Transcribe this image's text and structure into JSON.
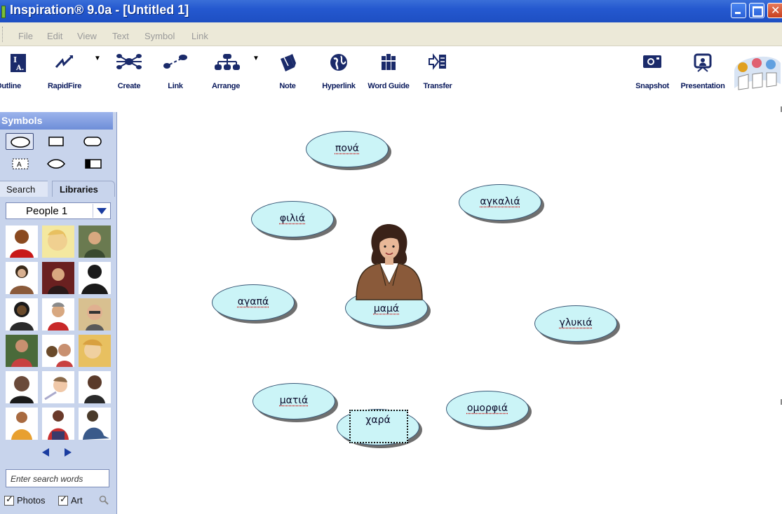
{
  "window": {
    "title": "Inspiration® 9.0a - [Untitled 1]"
  },
  "menu": [
    "File",
    "Edit",
    "View",
    "Text",
    "Symbol",
    "Link"
  ],
  "toolbar": {
    "outline": "Outline",
    "rapidfire": "RapidFire",
    "create": "Create",
    "link": "Link",
    "arrange": "Arrange",
    "note": "Note",
    "hyperlink": "Hyperlink",
    "word_guide": "Word Guide",
    "transfer": "Transfer",
    "snapshot": "Snapshot",
    "presentation": "Presentation"
  },
  "palette": {
    "title": "Symbols",
    "tabs": {
      "search": "Search",
      "libraries": "Libraries"
    },
    "library": "People 1",
    "search_placeholder": "Enter search words",
    "opt_photos": "Photos",
    "opt_art": "Art"
  },
  "diagram": {
    "center": "μαμά",
    "nodes": {
      "pona": "πονά",
      "agkalia": "αγκαλιά",
      "filia": "φιλιά",
      "agapa": "αγαπά",
      "glykia": "γλυκιά",
      "matia": "ματιά",
      "xara": "χαρά",
      "omorfia": "ομορφιά"
    }
  },
  "colors": {
    "node_fill": "#cbf4f7",
    "title_bar": "#2458cf",
    "toolbar_label": "#0a1a5c",
    "palette_bg": "#c8d4ec"
  }
}
